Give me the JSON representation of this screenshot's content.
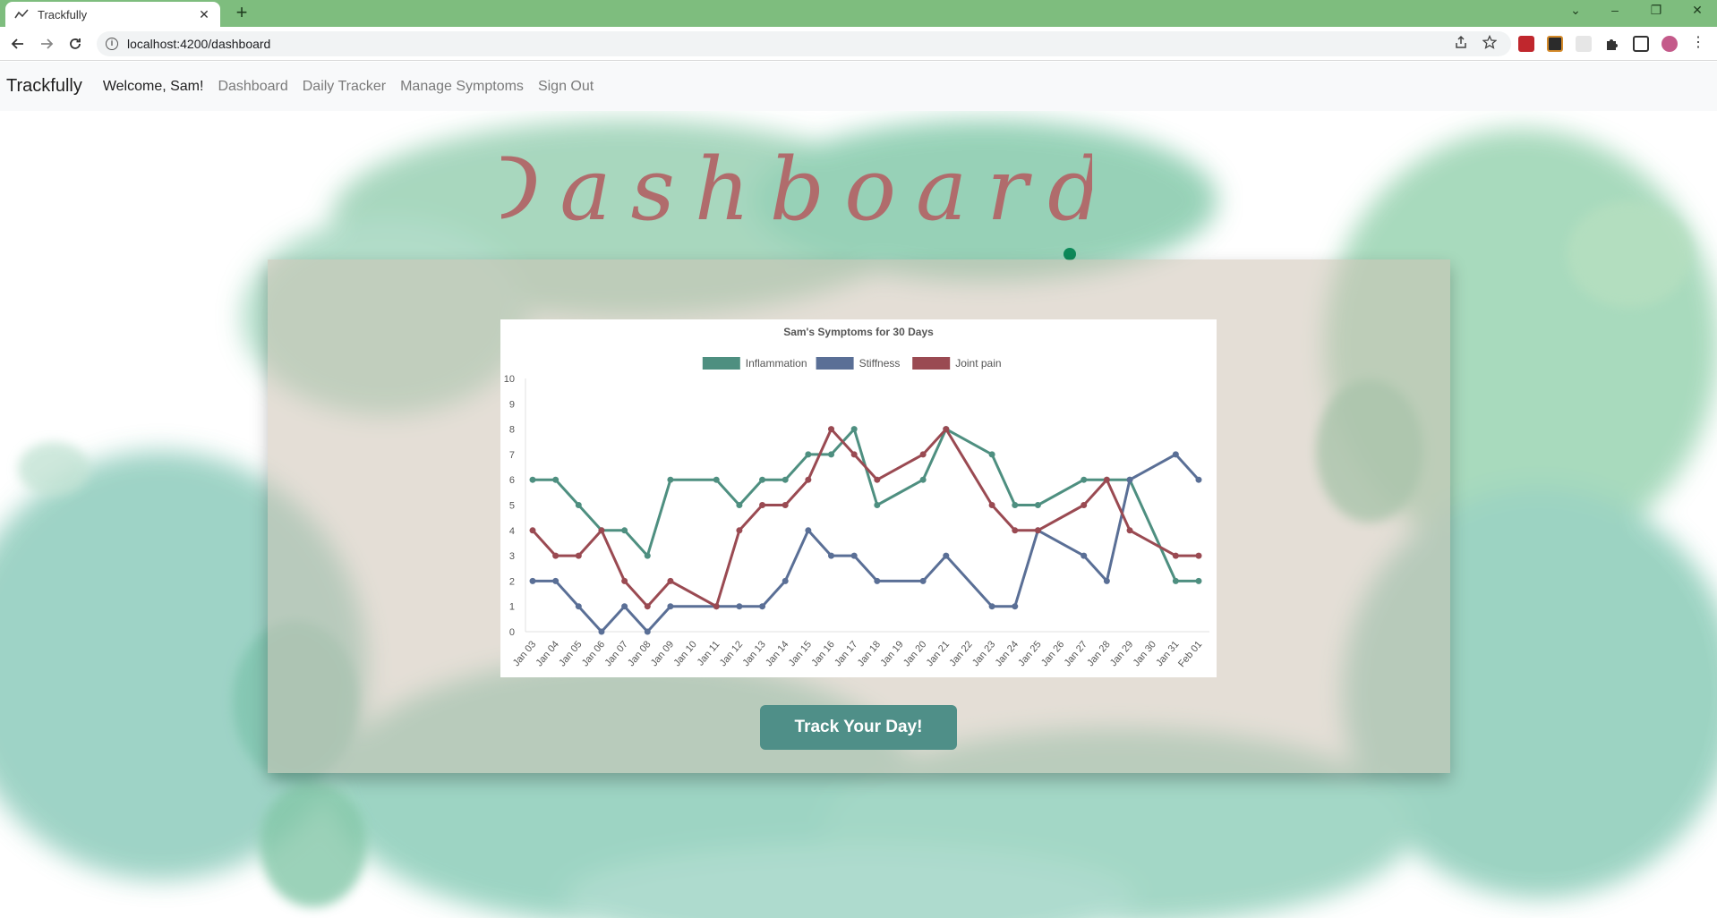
{
  "browser": {
    "tab_title": "Trackfully",
    "url": "localhost:4200/dashboard"
  },
  "navbar": {
    "brand": "Trackfully",
    "welcome": "Welcome, Sam!",
    "links": [
      "Dashboard",
      "Daily Tracker",
      "Manage Symptoms",
      "Sign Out"
    ]
  },
  "page": {
    "heading": "Dashboard",
    "button_label": "Track Your Day!"
  },
  "colors": {
    "inflammation": "#4e8f80",
    "stiffness": "#5a6f96",
    "joint_pain": "#9a4a52",
    "button": "#4f8f88",
    "heading": "#b06c6c"
  },
  "chart_data": {
    "type": "line",
    "title": "Sam's Symptoms for 30 Days",
    "ylim": [
      0,
      10
    ],
    "yticks": [
      0,
      1,
      2,
      3,
      4,
      5,
      6,
      7,
      8,
      9,
      10
    ],
    "legend_position": "top",
    "grid": false,
    "categories": [
      "Jan 03",
      "Jan 04",
      "Jan 05",
      "Jan 06",
      "Jan 07",
      "Jan 08",
      "Jan 09",
      "Jan 10",
      "Jan 11",
      "Jan 12",
      "Jan 13",
      "Jan 14",
      "Jan 15",
      "Jan 16",
      "Jan 17",
      "Jan 18",
      "Jan 19",
      "Jan 20",
      "Jan 21",
      "Jan 22",
      "Jan 23",
      "Jan 24",
      "Jan 25",
      "Jan 26",
      "Jan 27",
      "Jan 28",
      "Jan 29",
      "Jan 30",
      "Jan 31",
      "Feb 01"
    ],
    "series": [
      {
        "name": "Inflammation",
        "color": "#4e8f80",
        "points": [
          [
            0,
            6
          ],
          [
            1,
            6
          ],
          [
            2,
            5
          ],
          [
            3,
            4
          ],
          [
            4,
            4
          ],
          [
            5,
            3
          ],
          [
            6,
            6
          ],
          [
            8,
            6
          ],
          [
            9,
            5
          ],
          [
            10,
            6
          ],
          [
            11,
            6
          ],
          [
            12,
            7
          ],
          [
            13,
            7
          ],
          [
            14,
            8
          ],
          [
            15,
            5
          ],
          [
            17,
            6
          ],
          [
            18,
            8
          ],
          [
            20,
            7
          ],
          [
            21,
            5
          ],
          [
            22,
            5
          ],
          [
            24,
            6
          ],
          [
            25,
            6
          ],
          [
            26,
            6
          ],
          [
            28,
            2
          ],
          [
            29,
            2
          ]
        ]
      },
      {
        "name": "Stiffness",
        "color": "#5a6f96",
        "points": [
          [
            0,
            2
          ],
          [
            1,
            2
          ],
          [
            2,
            1
          ],
          [
            3,
            0
          ],
          [
            4,
            1
          ],
          [
            5,
            0
          ],
          [
            6,
            1
          ],
          [
            8,
            1
          ],
          [
            9,
            1
          ],
          [
            10,
            1
          ],
          [
            11,
            2
          ],
          [
            12,
            4
          ],
          [
            13,
            3
          ],
          [
            14,
            3
          ],
          [
            15,
            2
          ],
          [
            17,
            2
          ],
          [
            18,
            3
          ],
          [
            20,
            1
          ],
          [
            21,
            1
          ],
          [
            22,
            4
          ],
          [
            24,
            3
          ],
          [
            25,
            2
          ],
          [
            26,
            6
          ],
          [
            28,
            7
          ],
          [
            29,
            6
          ]
        ]
      },
      {
        "name": "Joint pain",
        "color": "#9a4a52",
        "points": [
          [
            0,
            4
          ],
          [
            1,
            3
          ],
          [
            2,
            3
          ],
          [
            3,
            4
          ],
          [
            4,
            2
          ],
          [
            5,
            1
          ],
          [
            6,
            2
          ],
          [
            8,
            1
          ],
          [
            9,
            4
          ],
          [
            10,
            5
          ],
          [
            11,
            5
          ],
          [
            12,
            6
          ],
          [
            13,
            8
          ],
          [
            14,
            7
          ],
          [
            15,
            6
          ],
          [
            17,
            7
          ],
          [
            18,
            8
          ],
          [
            20,
            5
          ],
          [
            21,
            4
          ],
          [
            22,
            4
          ],
          [
            24,
            5
          ],
          [
            25,
            6
          ],
          [
            26,
            4
          ],
          [
            28,
            3
          ],
          [
            29,
            3
          ]
        ]
      }
    ]
  }
}
